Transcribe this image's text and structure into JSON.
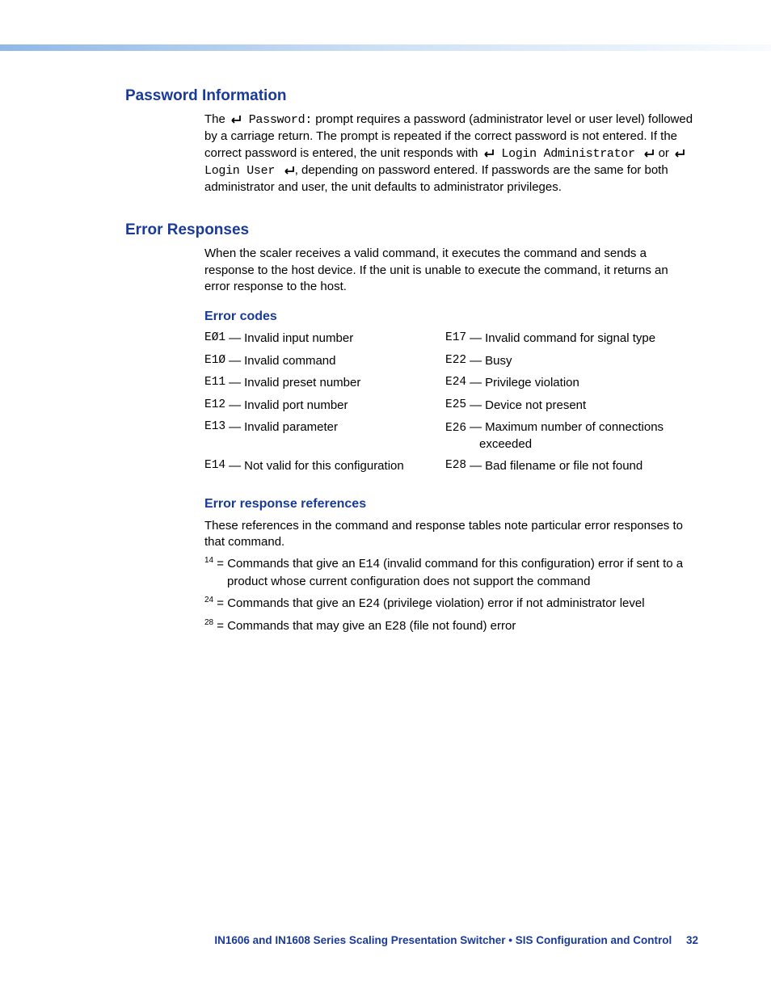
{
  "sections": {
    "password_info": {
      "heading": "Password Information",
      "p1a": "The ",
      "p1_code1": " Password:",
      "p1b": " prompt requires a password (administrator level or user level) followed by a carriage return. The prompt is repeated if the correct password is not entered. If the correct password is entered, the unit responds with ",
      "p1_code2": " Login Administrator ",
      "p1c": " or ",
      "p1_code3": " Login User ",
      "p1d": ", depending on password entered. If passwords are the same for both administrator and user, the unit defaults to administrator privileges."
    },
    "error_responses": {
      "heading": "Error Responses",
      "intro": "When the scaler receives a valid command, it executes the command and sends a response to the host device. If the unit is unable to execute the command, it returns an error response to the host.",
      "error_codes": {
        "heading": "Error codes",
        "rows": [
          {
            "l_code": "EØ1",
            "l_desc": "Invalid input number",
            "r_code": "E17",
            "r_desc": "Invalid command for signal type"
          },
          {
            "l_code": "E1Ø",
            "l_desc": "Invalid command",
            "r_code": "E22",
            "r_desc": "Busy"
          },
          {
            "l_code": "E11",
            "l_desc": "Invalid preset number",
            "r_code": "E24",
            "r_desc": "Privilege violation"
          },
          {
            "l_code": "E12",
            "l_desc": "Invalid port number",
            "r_code": "E25",
            "r_desc": "Device not present"
          },
          {
            "l_code": "E13",
            "l_desc": "Invalid parameter",
            "r_code": "E26",
            "r_desc": "Maximum number of connections exceeded"
          },
          {
            "l_code": "E14",
            "l_desc": "Not valid for this configuration",
            "r_code": "E28",
            "r_desc": "Bad filename or file not found"
          }
        ]
      },
      "error_refs": {
        "heading": "Error response references",
        "intro": "These references in the command and response tables note particular error responses to that command.",
        "items": [
          {
            "sup": "14",
            "pre": " = Commands that give an ",
            "code": "E14",
            "post": " (invalid command for this configuration) error if sent to a product whose current configuration does not support the command",
            "wrap": true
          },
          {
            "sup": "24",
            "pre": " = Commands that give an ",
            "code": "E24",
            "post": " (privilege violation) error if not administrator level",
            "wrap": false
          },
          {
            "sup": "28",
            "pre": " = Commands that may give an ",
            "code": "E28",
            "post": " (file not found) error",
            "wrap": false
          }
        ]
      }
    }
  },
  "footer": {
    "text": "IN1606 and IN1608 Series Scaling Presentation Switcher • SIS Configuration and Control",
    "page": "32"
  }
}
